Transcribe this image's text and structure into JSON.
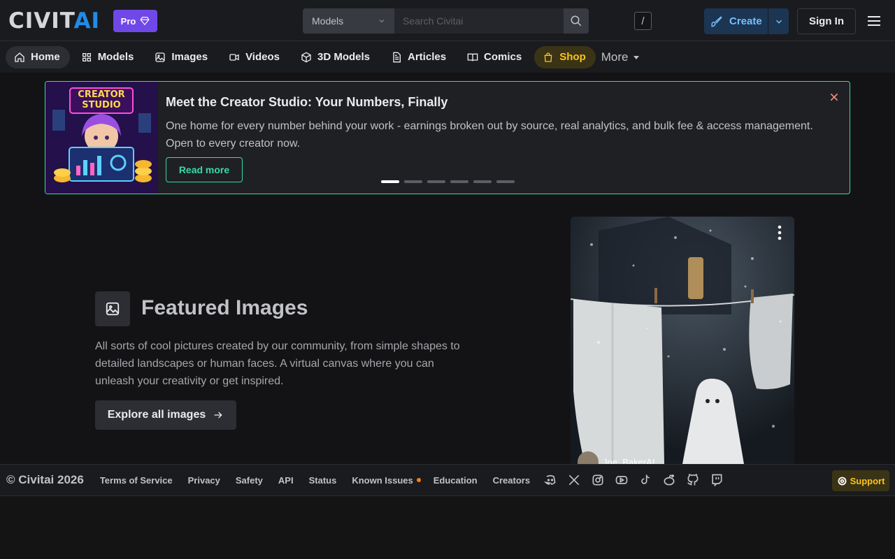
{
  "header": {
    "logo_left": "CIVIT",
    "logo_right": "AI",
    "pro_label": "Pro",
    "search_type": "Models",
    "search_placeholder": "Search Civitai",
    "search_shortcut": "/",
    "create_label": "Create",
    "signin_label": "Sign In"
  },
  "nav": {
    "items": [
      {
        "label": "Home",
        "icon": "home-icon"
      },
      {
        "label": "Models",
        "icon": "grid-icon"
      },
      {
        "label": "Images",
        "icon": "photo-icon"
      },
      {
        "label": "Videos",
        "icon": "video-icon"
      },
      {
        "label": "3D Models",
        "icon": "cube-icon"
      },
      {
        "label": "Articles",
        "icon": "article-icon"
      },
      {
        "label": "Comics",
        "icon": "book-icon"
      },
      {
        "label": "Shop",
        "icon": "shopping-bag-icon"
      }
    ],
    "more_label": "More"
  },
  "banner": {
    "image_text_line1": "CREATOR",
    "image_text_line2": "STUDIO",
    "title": "Meet the Creator Studio: Your Numbers, Finally",
    "description": "One home for every number behind your work - earnings broken out by source, real analytics, and bulk fee & access management. Open to every creator now.",
    "button_label": "Read more",
    "slide_count": 6,
    "active_slide": 1
  },
  "featured": {
    "title": "Featured Images",
    "description": "All sorts of cool pictures created by our community, from simple shapes to detailed landscapes or human faces. A virtual canvas where you can unleash your creativity or get inspired.",
    "button_label": "Explore all images",
    "card_username": "Joe_BakerAI"
  },
  "footer": {
    "copyright": "© Civitai 2026",
    "links": [
      "Terms of Service",
      "Privacy",
      "Safety",
      "API",
      "Status",
      "Known Issues",
      "Education",
      "Creators"
    ],
    "socials": [
      "discord-icon",
      "x-icon",
      "instagram-icon",
      "youtube-icon",
      "tiktok-icon",
      "reddit-icon",
      "github-icon",
      "twitch-icon"
    ],
    "support_label": "Support"
  },
  "colors": {
    "accent_blue": "#228be6",
    "pro_purple": "#7048e8",
    "banner_border": "#38d9a9",
    "shop_yellow": "#fcc419",
    "issue_orange": "#fd7e14"
  }
}
